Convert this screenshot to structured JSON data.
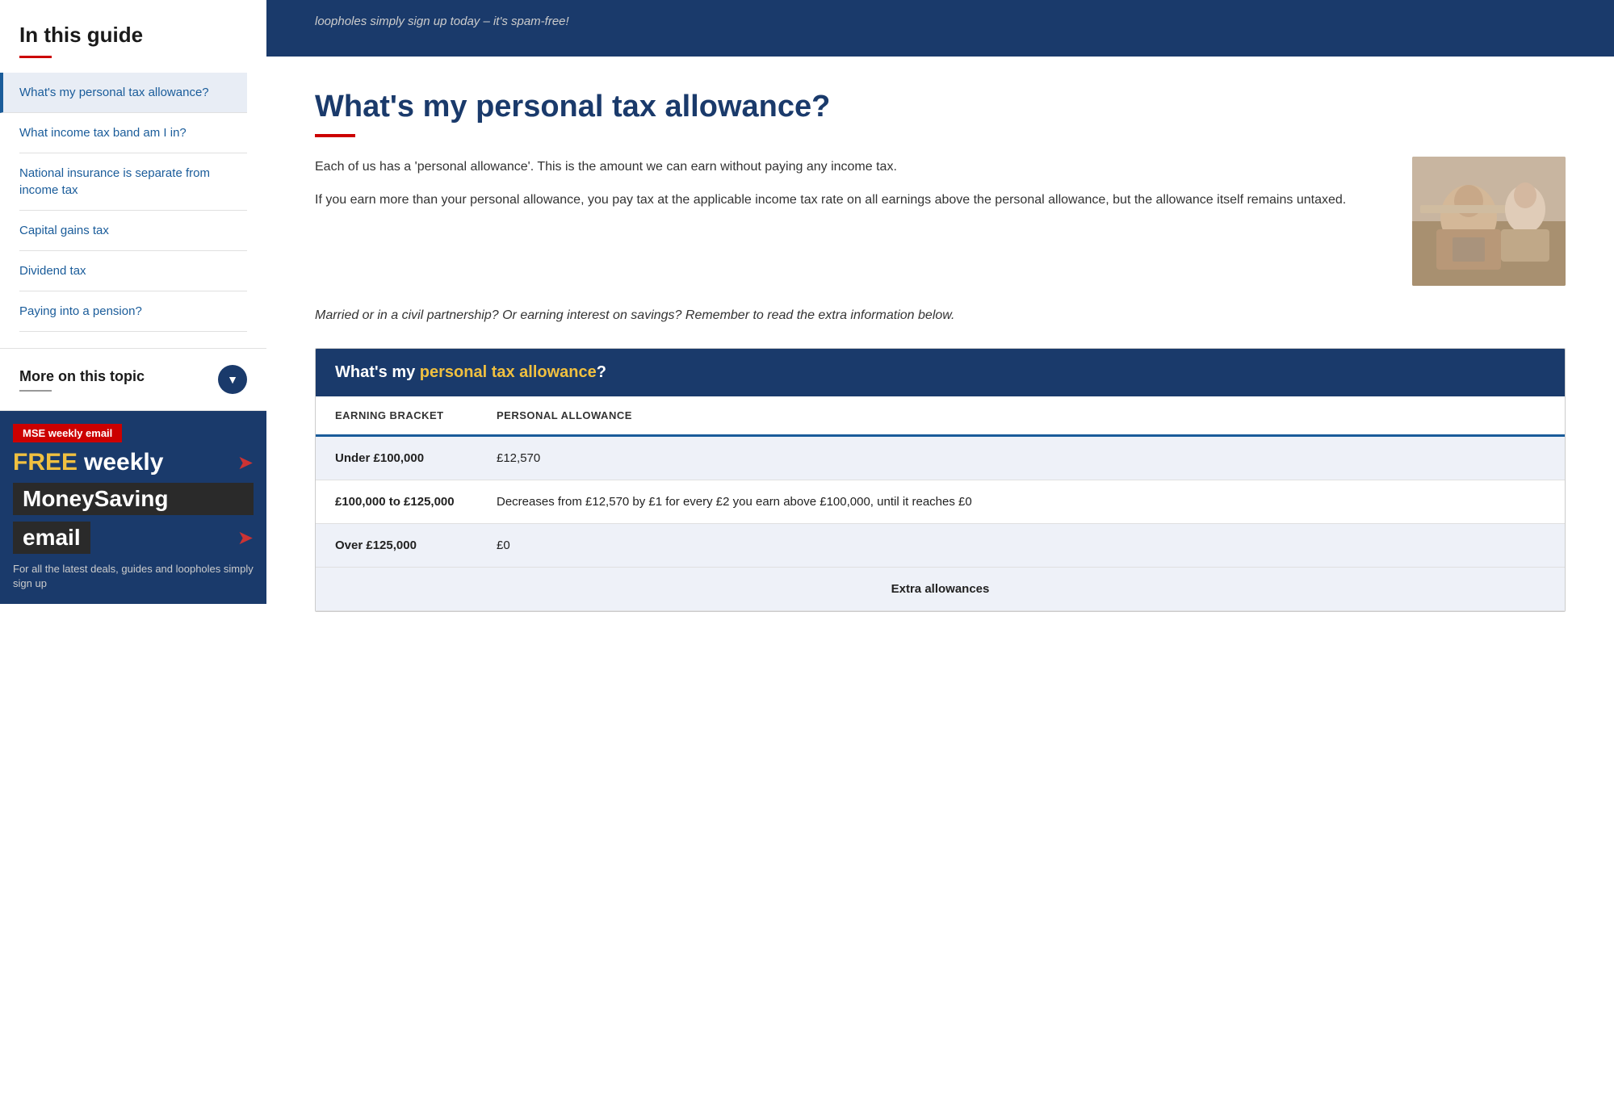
{
  "sidebar": {
    "guide_title": "In this guide",
    "nav_items": [
      {
        "label": "What's my personal tax allowance?",
        "active": true
      },
      {
        "label": "What income tax band am I in?",
        "active": false
      },
      {
        "label": "National insurance is separate from income tax",
        "active": false
      },
      {
        "label": "Capital gains tax",
        "active": false
      },
      {
        "label": "Dividend tax",
        "active": false
      },
      {
        "label": "Paying into a pension?",
        "active": false
      }
    ],
    "more_topic_label": "More on this topic",
    "email_promo": {
      "badge": "MSE weekly email",
      "free": "FREE",
      "weekly": " weekly",
      "moneysaving": "MoneySaving",
      "email": "email",
      "desc": "For all the latest deals, guides and loopholes simply sign up"
    }
  },
  "top_banner": {
    "text": "loopholes simply sign up today – it's spam-free!"
  },
  "article": {
    "title": "What's my personal tax allowance?",
    "intro1": "Each of us has a 'personal allowance'. This is the amount we can earn without paying any income tax.",
    "intro2": "If you earn more than your personal allowance, you pay tax at the applicable income tax rate on all earnings above the personal allowance, but the allowance itself remains untaxed.",
    "italic_note": "Married or in a civil partnership? Or earning interest on savings? Remember to read the extra information below.",
    "table_title_white": "What's my ",
    "table_title_highlight": "personal tax allowance",
    "table_title_end": "?",
    "table_headers": [
      "EARNING BRACKET",
      "PERSONAL ALLOWANCE"
    ],
    "table_rows": [
      {
        "bracket": "Under £100,000",
        "allowance": "£12,570"
      },
      {
        "bracket": "£100,000 to £125,000",
        "allowance": "Decreases from £12,570 by £1 for every £2 you earn above £100,000, until it reaches £0"
      },
      {
        "bracket": "Over £125,000",
        "allowance": "£0"
      }
    ],
    "extra_row_label": "Extra allowances"
  }
}
